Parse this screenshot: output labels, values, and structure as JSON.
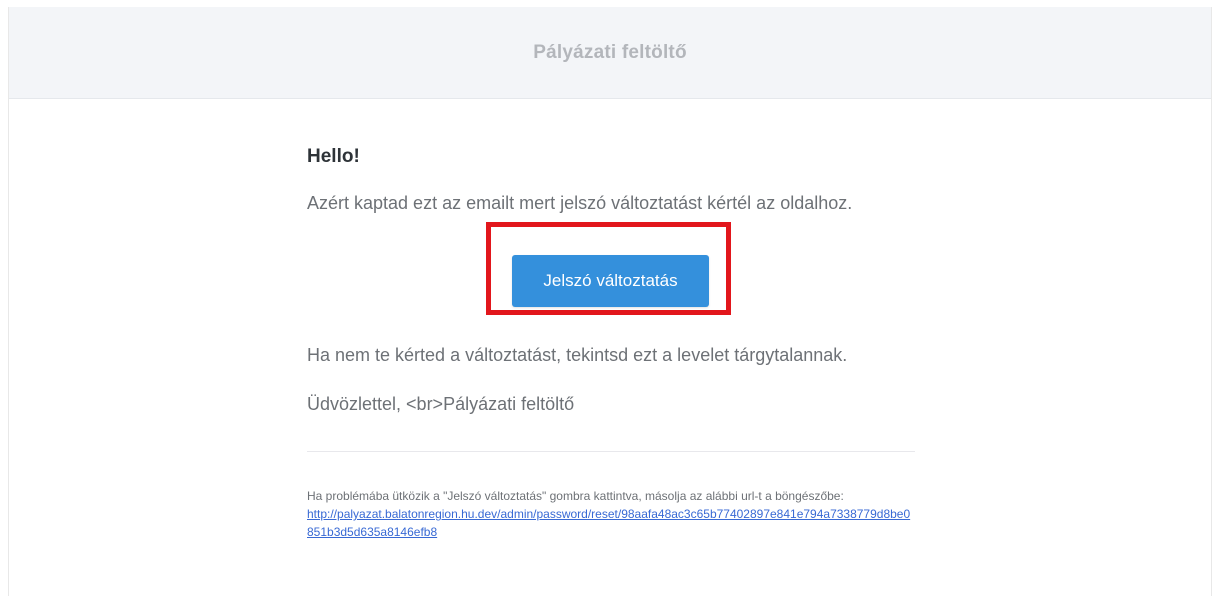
{
  "header": {
    "title": "Pályázati feltöltő"
  },
  "email": {
    "greeting": "Hello!",
    "intro": "Azért kaptad ezt az emailt mert jelszó változtatást kértél az oldalhoz.",
    "button_label": "Jelszó változtatás",
    "outro": "Ha nem te kérted a változtatást, tekintsd ezt a levelet tárgytalannak.",
    "salutation": "Üdvözlettel, <br>Pályázati feltöltő",
    "subcopy_text": "Ha problémába ütközik a \"Jelszó változtatás\" gombra kattintva, másolja az alábbi url-t a böngészőbe:",
    "reset_url": "http://palyazat.balatonregion.hu.dev/admin/password/reset/98aafa48ac3c65b77402897e841e794a7338779d8be0851b3d5d635a8146efb8"
  },
  "colors": {
    "header_bg": "#f3f5f8",
    "button_bg": "#3490dc",
    "highlight_border": "#e2161c",
    "link": "#3869d4"
  }
}
